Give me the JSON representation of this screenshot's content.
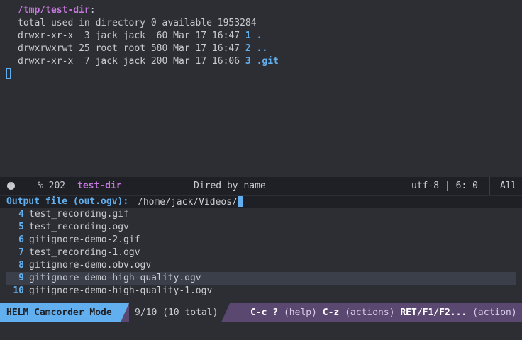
{
  "dired": {
    "header_path": "/tmp/test-dir",
    "header_colon": ":",
    "total_line": "total used in directory 0 available 1953284",
    "entries": [
      {
        "info": "drwxr-xr-x  3 jack jack  60 Mar 17 16:47",
        "num": "1",
        "name": "."
      },
      {
        "info": "drwxrwxrwt 25 root root 580 Mar 17 16:47",
        "num": "2",
        "name": ".."
      },
      {
        "info": "drwxr-xr-x  7 jack jack 200 Mar 17 16:06",
        "num": "3",
        "name": ".git"
      }
    ]
  },
  "modeline": {
    "warning_icon": "!",
    "position": "% 202",
    "buffer_name": "test-dir",
    "mode": "Dired by name",
    "encoding": "utf-8 | 6: 0",
    "scroll": "All"
  },
  "prompt": {
    "label": "Output file (out.ogv):",
    "value": "/home/jack/Videos/"
  },
  "helm": {
    "candidates": [
      {
        "num": "4",
        "name": "test_recording.gif",
        "selected": false
      },
      {
        "num": "5",
        "name": "test_recording.ogv",
        "selected": false
      },
      {
        "num": "6",
        "name": "gitignore-demo-2.gif",
        "selected": false
      },
      {
        "num": "7",
        "name": "test_recording-1.ogv",
        "selected": false
      },
      {
        "num": "8",
        "name": "gitignore-demo.obv.ogv",
        "selected": false
      },
      {
        "num": "9",
        "name": "gitignore-demo-high-quality.ogv",
        "selected": true
      },
      {
        "num": "10",
        "name": "gitignore-demo-high-quality-1.ogv",
        "selected": false
      }
    ],
    "mode_name": "HELM Camcorder Mode",
    "count": "9/10 (10 total)",
    "keys": {
      "k1": "C-c ?",
      "t1": " (help) ",
      "k2": "C-z",
      "t2": " (actions) ",
      "k3": "RET/F1/F2...",
      "t3": " (action)"
    }
  },
  "colors": {
    "background": "#2c2e33",
    "accent_blue": "#61afef",
    "accent_purple": "#c678dd",
    "helm_modeline": "#5a4870"
  }
}
